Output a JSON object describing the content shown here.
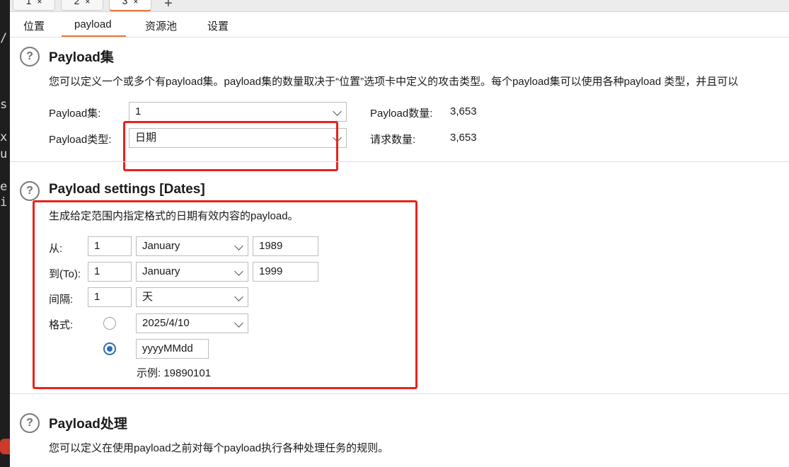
{
  "left_strip": {
    "glyphs": [
      "/:",
      "s",
      "x",
      "u",
      "e",
      "i"
    ]
  },
  "attack_tabs": [
    {
      "label": "1",
      "close": "×"
    },
    {
      "label": "2",
      "close": "×"
    },
    {
      "label": "3",
      "close": "×"
    }
  ],
  "add_tab": "+",
  "sub_tabs": [
    "位置",
    "payload",
    "资源池",
    "设置"
  ],
  "payload_sets": {
    "title": "Payload集",
    "description": "您可以定义一个或多个有payload集。payload集的数量取决于“位置”选项卡中定义的攻击类型。每个payload集可以使用各种payload 类型，并且可以",
    "set_label": "Payload集:",
    "set_value": "1",
    "type_label": "Payload类型:",
    "type_value": "日期",
    "count_label": "Payload数量:",
    "count_value": "3,653",
    "request_label": "请求数量:",
    "request_value": "3,653"
  },
  "payload_settings": {
    "title": "Payload settings [Dates]",
    "description": "生成给定范围内指定格式的日期有效内容的payload。",
    "from_label": "从:",
    "from_day": "1",
    "from_month": "January",
    "from_year": "1989",
    "to_label": "到(To):",
    "to_day": "1",
    "to_month": "January",
    "to_year": "1999",
    "step_label": "间隔:",
    "step_value": "1",
    "step_unit": "天",
    "format_label": "格式:",
    "format_preset": "2025/4/10",
    "format_custom": "yyyyMMdd",
    "example": "示例: 19890101"
  },
  "payload_processing": {
    "title": "Payload处理",
    "description": "您可以定义在使用payload之前对每个payload执行各种处理任务的规则。"
  },
  "icons": {
    "help": "?"
  },
  "colors": {
    "accent": "#e8763c",
    "annotation_red": "#e8231c",
    "radio_blue": "#2f6bb5"
  }
}
